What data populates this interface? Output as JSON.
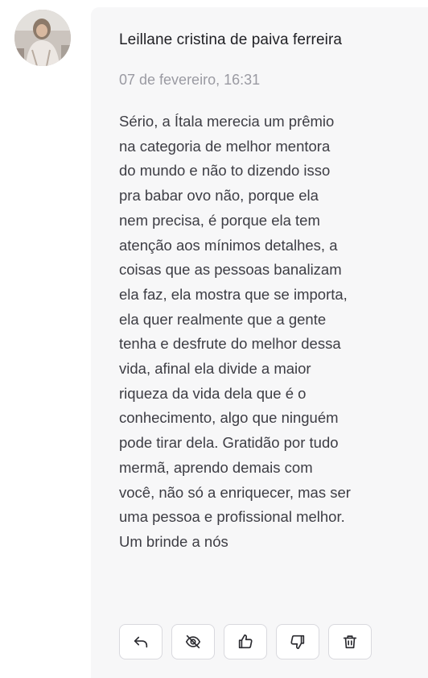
{
  "comment": {
    "author": "Leillane cristina de paiva ferreira",
    "timestamp": "07 de fevereiro, 16:31",
    "lines": [
      "Sério, a Ítala merecia um prêmio",
      "na categoria de melhor mentora",
      "do mundo e não to dizendo isso",
      "pra babar ovo não, porque ela",
      "nem precisa, é porque ela tem",
      "atenção aos mínimos detalhes, a",
      "coisas que as pessoas banalizam",
      "ela faz, ela mostra que se importa,",
      "ela quer realmente que a gente",
      "tenha e desfrute do melhor dessa",
      "vida, afinal ela divide a maior",
      "riqueza da vida dela que é o",
      "conhecimento, algo que ninguém",
      "pode tirar dela. Gratidão por tudo",
      "mermã, aprendo demais com",
      "você, não só a enriquecer, mas ser",
      "uma pessoa e profissional melhor.",
      "Um brinde a nós"
    ]
  },
  "actions": [
    {
      "name": "reply-button",
      "icon": "reply-icon"
    },
    {
      "name": "hide-button",
      "icon": "eye-off-icon"
    },
    {
      "name": "like-button",
      "icon": "thumbs-up-icon"
    },
    {
      "name": "dislike-button",
      "icon": "thumbs-down-icon"
    },
    {
      "name": "delete-button",
      "icon": "trash-icon"
    }
  ],
  "colors": {
    "card_background": "#f7f7f8",
    "author_text": "#1f1f24",
    "timestamp_text": "#9a9aa2",
    "body_text": "#3d3d44",
    "button_border": "#d9d9de"
  }
}
